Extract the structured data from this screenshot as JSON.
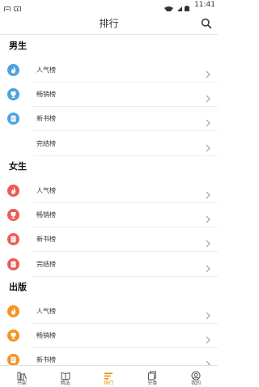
{
  "status_bar": {
    "time": "11:41"
  },
  "header": {
    "title": "排行"
  },
  "sections": [
    {
      "title": "男生",
      "color": "#4aa3e0",
      "items": [
        {
          "label": "人气榜",
          "icon": "flame-icon"
        },
        {
          "label": "畅销榜",
          "icon": "trophy-icon"
        },
        {
          "label": "新书榜",
          "icon": "book-icon"
        },
        {
          "label": "完结榜",
          "icon": "none"
        }
      ]
    },
    {
      "title": "女生",
      "color": "#ee5a55",
      "items": [
        {
          "label": "人气榜",
          "icon": "flame-icon"
        },
        {
          "label": "畅销榜",
          "icon": "trophy-icon"
        },
        {
          "label": "新书榜",
          "icon": "book-icon"
        },
        {
          "label": "完结榜",
          "icon": "document-icon"
        }
      ]
    },
    {
      "title": "出版",
      "color": "#f7931e",
      "items": [
        {
          "label": "人气榜",
          "icon": "flame-icon"
        },
        {
          "label": "畅销榜",
          "icon": "trophy-icon"
        },
        {
          "label": "新书榜",
          "icon": "book-icon"
        }
      ]
    }
  ],
  "tabbar": {
    "tabs": [
      {
        "label": "书架",
        "icon": "bookshelf-icon"
      },
      {
        "label": "精选",
        "icon": "open-book-icon"
      },
      {
        "label": "排行",
        "icon": "ranking-icon",
        "active": true
      },
      {
        "label": "分类",
        "icon": "category-icon"
      },
      {
        "label": "我的",
        "icon": "profile-icon"
      }
    ],
    "active_color": "#f08a00"
  }
}
